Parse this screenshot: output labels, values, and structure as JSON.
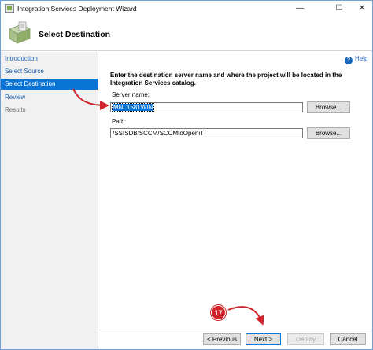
{
  "window": {
    "title": "Integration Services Deployment Wizard",
    "controls": {
      "minimize": "—",
      "maximize": "☐",
      "close": "✕"
    }
  },
  "header": {
    "title": "Select Destination",
    "icon": "wizard-page-icon"
  },
  "nav": {
    "items": [
      {
        "label": "Introduction",
        "state": "link"
      },
      {
        "label": "Select Source",
        "state": "link"
      },
      {
        "label": "Select Destination",
        "state": "active"
      },
      {
        "label": "Review",
        "state": "link"
      },
      {
        "label": "Results",
        "state": "disabled"
      }
    ]
  },
  "main": {
    "help_label": "Help",
    "help_icon": "?",
    "instruction": "Enter the destination server name and where the project will be located in the Integration Services catalog.",
    "server": {
      "label": "Server name:",
      "value": "MNL1581WIN",
      "browse_label": "Browse..."
    },
    "path": {
      "label": "Path:",
      "value": "/SSISDB/SCCM/SCCMtoOpeniT",
      "browse_label": "Browse..."
    }
  },
  "footer": {
    "previous_label": "< Previous",
    "next_label": "Next >",
    "deploy_label": "Deploy",
    "cancel_label": "Cancel"
  },
  "annotation": {
    "step_number": "17",
    "color": "#d0232b"
  },
  "colors": {
    "accent": "#0a74d4",
    "link": "#1a5fb4",
    "nav_background": "#f1f1f1"
  }
}
